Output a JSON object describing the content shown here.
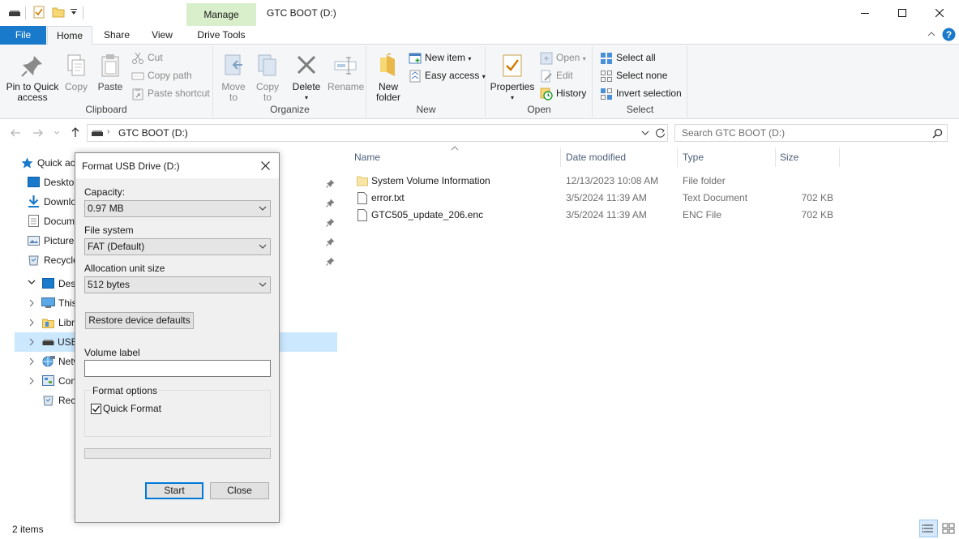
{
  "window": {
    "title": "GTC BOOT (D:)",
    "context_tab_label": "Manage"
  },
  "tabs": {
    "file": "File",
    "home": "Home",
    "share": "Share",
    "view": "View",
    "drive_tools": "Drive Tools"
  },
  "ribbon": {
    "clipboard": {
      "label": "Clipboard",
      "pin": "Pin to Quick access",
      "pin_l1": "Pin to Quick",
      "pin_l2": "access",
      "copy": "Copy",
      "paste": "Paste",
      "cut": "Cut",
      "copy_path": "Copy path",
      "paste_shortcut": "Paste shortcut"
    },
    "organize": {
      "label": "Organize",
      "move_l1": "Move",
      "move_l2": "to",
      "copy_l1": "Copy",
      "copy_l2": "to",
      "delete": "Delete",
      "rename": "Rename"
    },
    "new": {
      "label": "New",
      "new_folder_l1": "New",
      "new_folder_l2": "folder",
      "new_item": "New item",
      "easy_access": "Easy access"
    },
    "open": {
      "label": "Open",
      "properties": "Properties",
      "open": "Open",
      "edit": "Edit",
      "history": "History"
    },
    "select": {
      "label": "Select",
      "select_all": "Select all",
      "select_none": "Select none",
      "invert": "Invert selection"
    }
  },
  "address": {
    "path": "GTC BOOT (D:)",
    "search_placeholder": "Search GTC BOOT (D:)"
  },
  "nav": {
    "items": [
      {
        "label": "Quick ac"
      },
      {
        "label": "Desktop"
      },
      {
        "label": "Downlo"
      },
      {
        "label": "Docum"
      },
      {
        "label": "Picture"
      },
      {
        "label": "Recycle"
      },
      {
        "label": "Des"
      },
      {
        "label": "This"
      },
      {
        "label": "Libr"
      },
      {
        "label": "USB"
      },
      {
        "label": "Netw"
      },
      {
        "label": "Con"
      },
      {
        "label": "Recy"
      }
    ]
  },
  "columns": {
    "name": "Name",
    "date": "Date modified",
    "type": "Type",
    "size": "Size"
  },
  "files": [
    {
      "name": "System Volume Information",
      "date": "12/13/2023 10:08 AM",
      "type": "File folder",
      "size": ""
    },
    {
      "name": "error.txt",
      "date": "3/5/2024 11:39 AM",
      "type": "Text Document",
      "size": "702 KB"
    },
    {
      "name": "GTC505_update_206.enc",
      "date": "3/5/2024 11:39 AM",
      "type": "ENC File",
      "size": "702 KB"
    }
  ],
  "status": {
    "count": "2 items"
  },
  "dialog": {
    "title": "Format USB Drive (D:)",
    "capacity_label": "Capacity:",
    "capacity_value": "0.97 MB",
    "fs_label": "File system",
    "fs_value": "FAT (Default)",
    "alloc_label": "Allocation unit size",
    "alloc_value": "512 bytes",
    "restore_button": "Restore device defaults",
    "volume_label": "Volume label",
    "volume_value": "",
    "options_label": "Format options",
    "quick_format": "Quick Format",
    "quick_format_checked": true,
    "start_button": "Start",
    "close_button": "Close"
  },
  "colors": {
    "accent": "#1979ca",
    "context_tab": "#d9eecb",
    "selection": "#cce8ff"
  }
}
